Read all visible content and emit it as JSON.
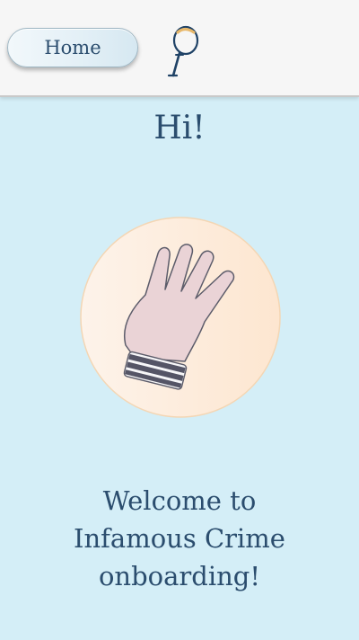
{
  "header": {
    "home_label": "Home",
    "logo_icon": "magnifying-glass-logo"
  },
  "main": {
    "greeting": "Hi!",
    "illustration_icon": "waving-hand-icon",
    "welcome_lines": [
      "Welcome to",
      "Infamous Crime",
      "onboarding!"
    ]
  },
  "colors": {
    "background": "#d4eef7",
    "header_background": "#f6f6f6",
    "text": "#2b4d6e",
    "circle_fill": "#fdeee0",
    "hand_fill": "#ead3d6"
  }
}
